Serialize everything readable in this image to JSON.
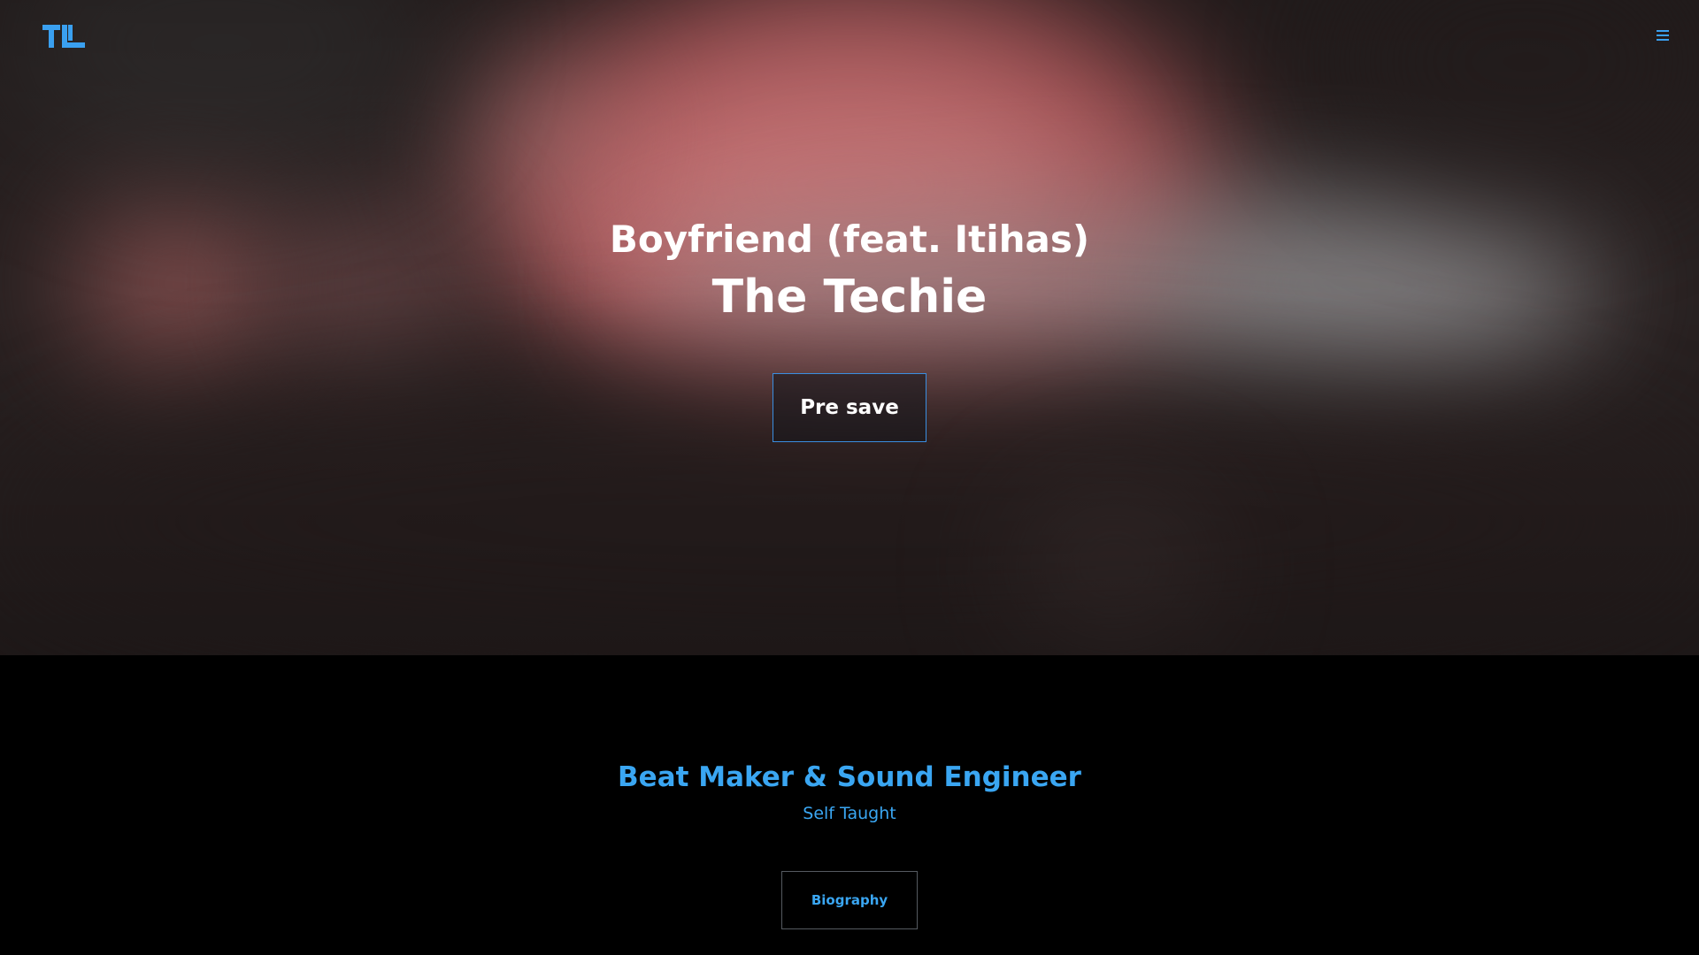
{
  "hero": {
    "song_title": "Boyfriend (feat. Itihas)",
    "artist": "The Techie",
    "presave_label": "Pre save"
  },
  "header": {
    "logo_text": "TL",
    "menu_icon": "hamburger-menu-icon"
  },
  "about": {
    "role": "Beat Maker & Sound Engineer",
    "subtitle": "Self Taught",
    "biography_label": "Biography"
  },
  "colors": {
    "accent": "#3aa6f2",
    "background": "#000000",
    "hero_text": "#ffffff"
  }
}
